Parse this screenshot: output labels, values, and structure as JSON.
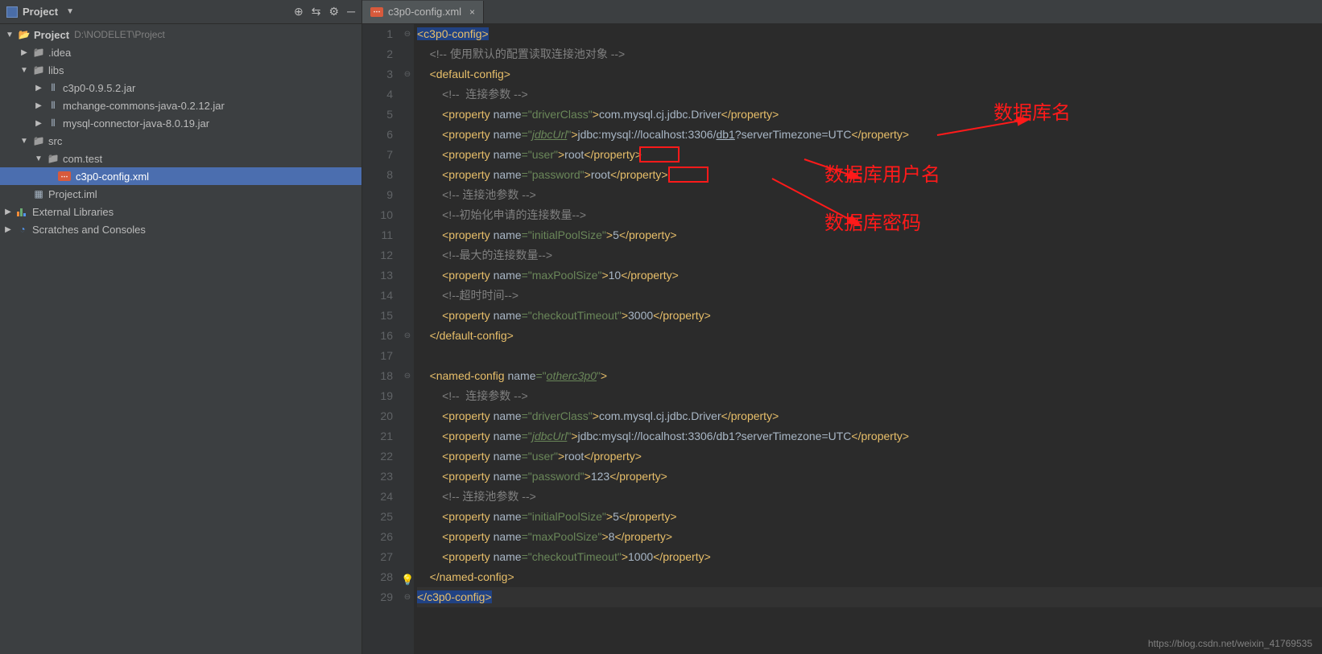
{
  "projectHeader": {
    "title": "Project",
    "icons": [
      "target-icon",
      "collapse-icon",
      "gear-icon",
      "hide-icon"
    ]
  },
  "tree": {
    "root": {
      "name": "Project",
      "path": "D:\\NODELET\\Project"
    },
    "items": [
      {
        "name": ".idea",
        "type": "folder",
        "expanded": false,
        "indent": 1
      },
      {
        "name": "libs",
        "type": "folder",
        "expanded": true,
        "indent": 1
      },
      {
        "name": "c3p0-0.9.5.2.jar",
        "type": "jar",
        "indent": 2
      },
      {
        "name": "mchange-commons-java-0.2.12.jar",
        "type": "jar",
        "indent": 2
      },
      {
        "name": "mysql-connector-java-8.0.19.jar",
        "type": "jar",
        "indent": 2
      },
      {
        "name": "src",
        "type": "folder",
        "expanded": true,
        "indent": 1
      },
      {
        "name": "com.test",
        "type": "package",
        "expanded": true,
        "indent": 2
      },
      {
        "name": "c3p0-config.xml",
        "type": "xml",
        "indent": 3,
        "selected": true
      },
      {
        "name": "Project.iml",
        "type": "iml",
        "indent": 1
      }
    ],
    "external": "External Libraries",
    "scratches": "Scratches and Consoles"
  },
  "tab": {
    "name": "c3p0-config.xml"
  },
  "code": {
    "lines": 29,
    "line1": {
      "tag_open": "<c3p0-config>"
    },
    "line2": {
      "comment": "<!-- 使用默认的配置读取连接池对象 -->"
    },
    "line3": {
      "tag_open": "<default-config>"
    },
    "line4": {
      "comment": "<!--  连接参数 -->"
    },
    "line5": {
      "prop": "property",
      "name_attr": "name",
      "name_val": "driverClass",
      "text": "com.mysql.cj.jdbc.Driver"
    },
    "line6": {
      "prop": "property",
      "name_attr": "name",
      "name_val": "jdbcUrl",
      "text_pre": "jdbc:mysql://localhost:3306/",
      "db": "db1",
      "text_post": "?serverTimezone=UTC"
    },
    "line7": {
      "prop": "property",
      "name_attr": "name",
      "name_val": "user",
      "text": "root"
    },
    "line8": {
      "prop": "property",
      "name_attr": "name",
      "name_val": "password",
      "text": "root"
    },
    "line9": {
      "comment": "<!-- 连接池参数 -->"
    },
    "line10": {
      "comment": "<!--初始化申请的连接数量-->"
    },
    "line11": {
      "prop": "property",
      "name_attr": "name",
      "name_val": "initialPoolSize",
      "text": "5"
    },
    "line12": {
      "comment": "<!--最大的连接数量-->"
    },
    "line13": {
      "prop": "property",
      "name_attr": "name",
      "name_val": "maxPoolSize",
      "text": "10"
    },
    "line14": {
      "comment": "<!--超时时间-->"
    },
    "line15": {
      "prop": "property",
      "name_attr": "name",
      "name_val": "checkoutTimeout",
      "text": "3000"
    },
    "line16": {
      "tag_close": "</default-config>"
    },
    "line18": {
      "tag_open": "<named-config",
      "name_attr": "name",
      "name_val": "otherc3p0",
      "tag_end": ">"
    },
    "line19": {
      "comment": "<!--  连接参数 -->"
    },
    "line20": {
      "prop": "property",
      "name_attr": "name",
      "name_val": "driverClass",
      "text": "com.mysql.cj.jdbc.Driver"
    },
    "line21": {
      "prop": "property",
      "name_attr": "name",
      "name_val": "jdbcUrl",
      "text": "jdbc:mysql://localhost:3306/db1?serverTimezone=UTC"
    },
    "line22": {
      "prop": "property",
      "name_attr": "name",
      "name_val": "user",
      "text": "root"
    },
    "line23": {
      "prop": "property",
      "name_attr": "name",
      "name_val": "password",
      "text": "123"
    },
    "line24": {
      "comment": "<!-- 连接池参数 -->"
    },
    "line25": {
      "prop": "property",
      "name_attr": "name",
      "name_val": "initialPoolSize",
      "text": "5"
    },
    "line26": {
      "prop": "property",
      "name_attr": "name",
      "name_val": "maxPoolSize",
      "text": "8"
    },
    "line27": {
      "prop": "property",
      "name_attr": "name",
      "name_val": "checkoutTimeout",
      "text": "1000"
    },
    "line28": {
      "tag_close": "</named-config>"
    },
    "line29": {
      "tag_close": "</c3p0-config>"
    }
  },
  "annotations": {
    "a1": "数据库名",
    "a2": "数据库用户名",
    "a3": "数据库密码"
  },
  "watermark": "https://blog.csdn.net/weixin_41769535"
}
